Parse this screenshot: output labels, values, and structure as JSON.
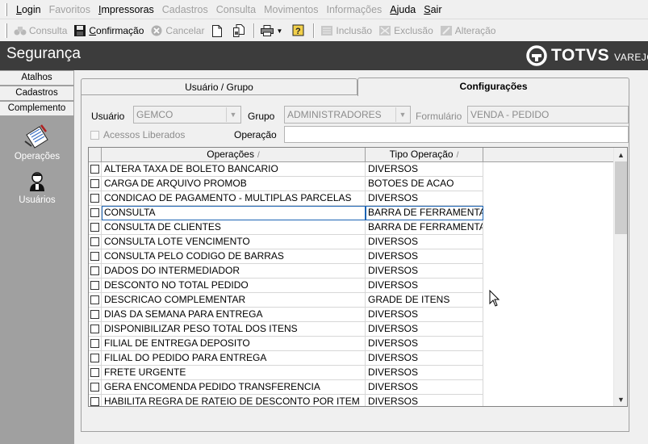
{
  "menu": {
    "items": [
      {
        "label": "Login",
        "ul": "L",
        "rest": "ogin",
        "enabled": true
      },
      {
        "label": "Favoritos",
        "ul": "",
        "rest": "Favoritos",
        "enabled": false
      },
      {
        "label": "Impressoras",
        "ul": "I",
        "rest": "mpressoras",
        "enabled": true
      },
      {
        "label": "Cadastros",
        "ul": "",
        "rest": "Cadastros",
        "enabled": false
      },
      {
        "label": "Consulta",
        "ul": "",
        "rest": "Consulta",
        "enabled": false
      },
      {
        "label": "Movimentos",
        "ul": "",
        "rest": "Movimentos",
        "enabled": false
      },
      {
        "label": "Informações",
        "ul": "",
        "rest": "Informações",
        "enabled": false
      },
      {
        "label": "Ajuda",
        "ul": "A",
        "rest": "juda",
        "enabled": true
      },
      {
        "label": "Sair",
        "ul": "S",
        "rest": "air",
        "enabled": true
      }
    ]
  },
  "toolbar": {
    "consulta": "Consulta",
    "confirmacao_ul": "C",
    "confirmacao_rest": "onfirmação",
    "cancelar": "Cancelar",
    "inclusao": "Inclusão",
    "exclusao": "Exclusão",
    "alteracao": "Alteração"
  },
  "header": {
    "title": "Segurança",
    "logo_brand": "TOTVS",
    "logo_sub": "VAREJO"
  },
  "sidebar": {
    "sections": [
      "Atalhos",
      "Cadastros",
      "Complemento"
    ],
    "items": [
      {
        "label": "Operações",
        "icon": "operations-icon"
      },
      {
        "label": "Usuários",
        "icon": "users-icon"
      }
    ]
  },
  "tabs": {
    "tab1": "Usuário  / Grupo",
    "tab2": "Configurações"
  },
  "filters": {
    "usuario_label": "Usuário",
    "usuario_value": "GEMCO",
    "grupo_label": "Grupo",
    "grupo_value": "ADMINISTRADORES",
    "formulario_label": "Formulário",
    "formulario_value": "VENDA - PEDIDO",
    "acessos_label": "Acessos Liberados",
    "operacao_label": "Operação",
    "operacao_value": ""
  },
  "grid": {
    "col_operacoes": "Operações",
    "col_tipo": "Tipo Operação",
    "sort_glyph": "/",
    "selected_row": 3,
    "rows": [
      {
        "op": "ALTERA TAXA DE BOLETO BANCARIO",
        "tipo": "DIVERSOS"
      },
      {
        "op": "CARGA DE ARQUIVO PROMOB",
        "tipo": "BOTOES DE ACAO"
      },
      {
        "op": "CONDICAO DE PAGAMENTO - MULTIPLAS PARCELAS",
        "tipo": "DIVERSOS"
      },
      {
        "op": "CONSULTA",
        "tipo": "BARRA DE FERRAMENTAS"
      },
      {
        "op": "CONSULTA DE CLIENTES",
        "tipo": "BARRA DE FERRAMENTAS"
      },
      {
        "op": "CONSULTA LOTE VENCIMENTO",
        "tipo": "DIVERSOS"
      },
      {
        "op": "CONSULTA PELO CODIGO DE BARRAS",
        "tipo": "DIVERSOS"
      },
      {
        "op": "DADOS DO INTERMEDIADOR",
        "tipo": "DIVERSOS"
      },
      {
        "op": "DESCONTO NO TOTAL PEDIDO",
        "tipo": "DIVERSOS"
      },
      {
        "op": "DESCRICAO COMPLEMENTAR",
        "tipo": "GRADE DE ITENS"
      },
      {
        "op": "DIAS DA SEMANA PARA ENTREGA",
        "tipo": "DIVERSOS"
      },
      {
        "op": "DISPONIBILIZAR PESO TOTAL DOS ITENS",
        "tipo": "DIVERSOS"
      },
      {
        "op": "FILIAL DE ENTREGA DEPOSITO",
        "tipo": "DIVERSOS"
      },
      {
        "op": "FILIAL DO PEDIDO PARA ENTREGA",
        "tipo": "DIVERSOS"
      },
      {
        "op": "FRETE URGENTE",
        "tipo": "DIVERSOS"
      },
      {
        "op": "GERA ENCOMENDA PEDIDO TRANSFERENCIA",
        "tipo": "DIVERSOS"
      },
      {
        "op": "HABILITA REGRA DE RATEIO DE DESCONTO POR ITEM",
        "tipo": "DIVERSOS"
      }
    ]
  }
}
